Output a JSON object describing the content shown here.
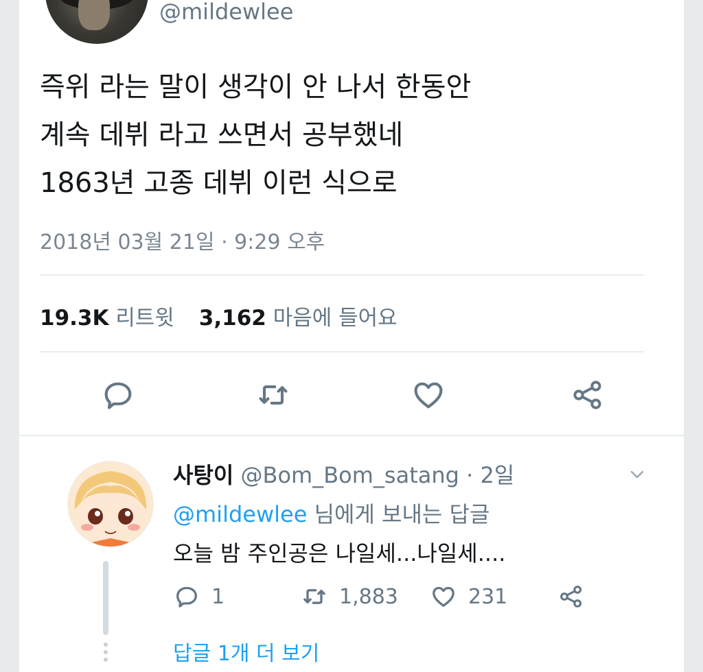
{
  "tweet": {
    "handle": "@mildewlee",
    "text": "즉위 라는 말이 생각이 안 나서 한동안\n계속 데뷔 라고 쓰면서 공부했네\n1863년 고종 데뷔 이런 식으로",
    "timestamp": "2018년 03월 21일 · 9:29 오후",
    "retweet_count": "19.3K",
    "retweet_label": "리트윗",
    "like_count": "3,162",
    "like_label": "마음에 들어요"
  },
  "actions": [
    {
      "name": "reply",
      "icon": "comment-icon"
    },
    {
      "name": "retweet",
      "icon": "retweet-icon"
    },
    {
      "name": "like",
      "icon": "heart-icon"
    },
    {
      "name": "share",
      "icon": "share-icon"
    }
  ],
  "reply": {
    "display_name": "사탕이",
    "handle": "@Bom_Bom_satang",
    "time": "· 2일",
    "reply_to_mention": "@mildewlee",
    "reply_to_suffix": "님에게 보내는 답글",
    "text": "오늘 밤 주인공은 나일세...나일세....",
    "reply_count": "1",
    "retweet_count": "1,883",
    "like_count": "231",
    "more_replies": "답글 1개 더 보기"
  },
  "colors": {
    "accent": "#1da1f2",
    "muted": "#657786",
    "icon": "#657786",
    "divider": "#e6ecf0"
  }
}
